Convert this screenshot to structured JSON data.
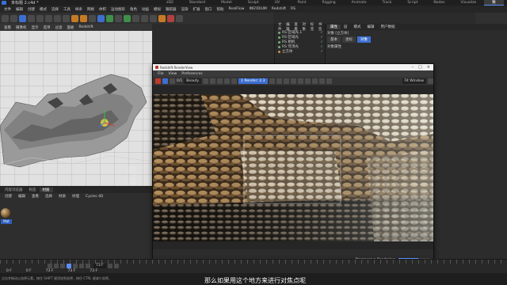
{
  "window": {
    "doc_title": "未标题 2.c4d *"
  },
  "layout_tabs": [
    "zSD",
    "Standard",
    "Model",
    "Sculpt",
    "UV Edit",
    "Paint",
    "Rigging",
    "Animate",
    "Track",
    "Script",
    "Nodes",
    "Visualize",
    "数字布局"
  ],
  "layout_tabs_active": 12,
  "menubar": [
    "文件",
    "编辑",
    "创建",
    "模式",
    "选择",
    "工具",
    "样条",
    "网格",
    "体积",
    "运动图形",
    "角色",
    "动画",
    "模拟",
    "跟踪器",
    "渲染",
    "扩展",
    "窗口",
    "帮助",
    "RealFlow",
    "INSYDIUM",
    "Redshift",
    "RS"
  ],
  "toolbar": {
    "items": [
      "对象",
      "视图",
      "摄像机",
      "显示",
      "选项",
      "过滤",
      "面板",
      "Redshift"
    ]
  },
  "viewport": {
    "menu": [
      "查看",
      "摄像机",
      "显示",
      "选项",
      "过滤",
      "面板",
      "Redshift"
    ]
  },
  "object_manager": {
    "menu": [
      "文件",
      "编辑",
      "查看",
      "对象",
      "标签",
      "书签"
    ],
    "rows": [
      "RS 区域光.1",
      "RS 区域光",
      "RS 相机",
      "RS 穹顶光",
      "立方体"
    ]
  },
  "attributes": {
    "tabs": [
      "属性",
      "层"
    ],
    "active_tab": 0,
    "menu": [
      "模式",
      "编辑",
      "用户数据"
    ],
    "header": "对象 [立方体]",
    "modes": [
      "基本",
      "坐标",
      "对象"
    ],
    "active_mode": 2,
    "section_title": "对象属性"
  },
  "material_manager": {
    "tabs": [
      "内容浏览器",
      "构造",
      "材质"
    ],
    "active_tab": 2,
    "menu": [
      "创建",
      "编辑",
      "查看",
      "选择",
      "材质",
      "纹理",
      "Cycles 4D"
    ],
    "material_label": "Mat"
  },
  "watermark": "电\n课",
  "renderview": {
    "title": "Redshift RenderView",
    "menu": [
      "File",
      "View",
      "Preferences"
    ],
    "toolbar": {
      "frame": "0/1",
      "mode": "Beauty",
      "aov": "1 Render: 2 3",
      "zoom": "Fit Window"
    },
    "status_label": "Progressive Rendering",
    "progress": 0.62
  },
  "timeline": {
    "frame_current": "73 F",
    "vals": [
      "0 F",
      "0 F",
      "73 F",
      "73 F",
      "73 F"
    ]
  },
  "status_text": "点击并拖动以选择元素。按住 SHIFT 键添加到选择，按住 CTRL 键减少选择。",
  "subtitle": "那么如果用这个地方来进行对焦点呢",
  "colors": {
    "accent": "#3d6fd1",
    "panel": "#2c2c2c",
    "viewport_bg": "#e1e1e1"
  }
}
